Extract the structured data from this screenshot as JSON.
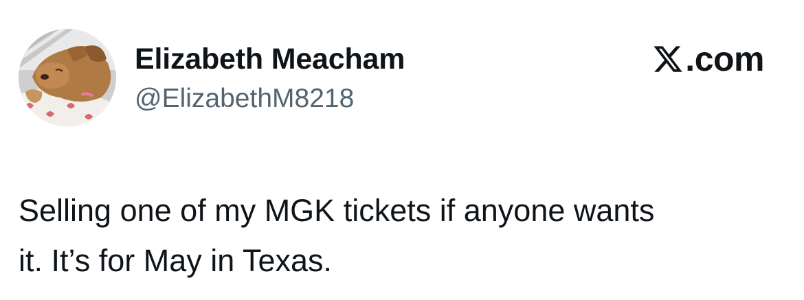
{
  "author": {
    "display_name": "Elizabeth Meacham",
    "handle": "@ElizabethM8218",
    "avatar_icon": "dog-avatar-photo"
  },
  "brand": {
    "icon": "x-logo-icon",
    "suffix": ".com"
  },
  "tweet": {
    "text_line_1": "Selling one of my MGK tickets if anyone wants",
    "text_line_2": "it. It’s for May in Texas."
  },
  "colors": {
    "text_primary": "#0f1419",
    "text_secondary": "#536471",
    "background": "#ffffff"
  }
}
